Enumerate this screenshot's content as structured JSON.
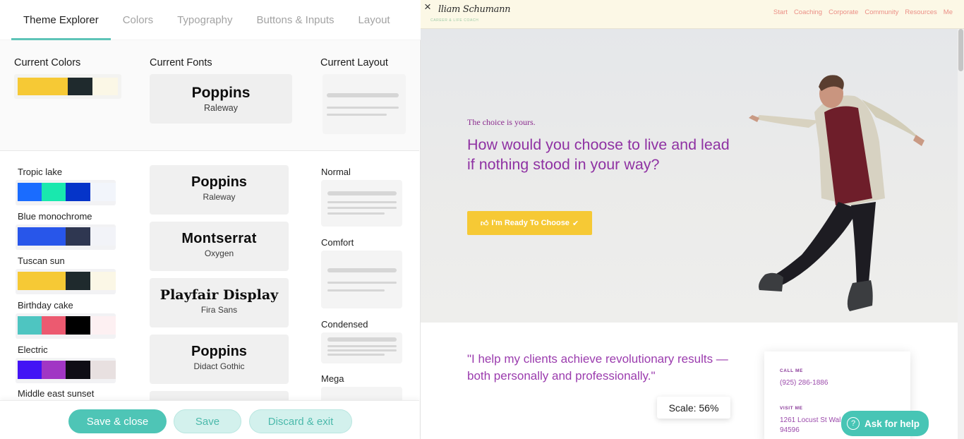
{
  "editor": {
    "tabs": [
      {
        "label": "Theme Explorer",
        "active": true
      },
      {
        "label": "Colors",
        "active": false
      },
      {
        "label": "Typography",
        "active": false
      },
      {
        "label": "Buttons & Inputs",
        "active": false
      },
      {
        "label": "Layout",
        "active": false
      }
    ],
    "current": {
      "colors_label": "Current Colors",
      "fonts_label": "Current Fonts",
      "layout_label": "Current Layout",
      "colors": [
        "#f6c935",
        "#1f2a2d",
        "#fbf7e6"
      ],
      "font_primary": "Poppins",
      "font_secondary": "Raleway"
    },
    "palettes": [
      {
        "name": "Tropic lake",
        "colors": [
          "#1a6cff",
          "#19e8ae",
          "#0534c9",
          "#f2f5fb"
        ]
      },
      {
        "name": "Blue monochrome",
        "colors": [
          "#2856ea",
          "#2856ea",
          "#2f3751",
          "#f2f3f8"
        ]
      },
      {
        "name": "Tuscan sun",
        "colors": [
          "#f6c935",
          "#f6c935",
          "#1f2a2d",
          "#fbf7e6"
        ]
      },
      {
        "name": "Birthday cake",
        "colors": [
          "#4ec5c1",
          "#ec5a70",
          "#000000",
          "#fdf0f2"
        ]
      },
      {
        "name": "Electric",
        "colors": [
          "#4313f5",
          "#a136c4",
          "#0f0d15",
          "#e8e0e0"
        ]
      },
      {
        "name": "Middle east sunset",
        "colors": []
      }
    ],
    "fonts": [
      {
        "primary": "Poppins",
        "secondary": "Raleway"
      },
      {
        "primary": "Montserrat",
        "secondary": "Oxygen"
      },
      {
        "primary": "Playfair Display",
        "secondary": "Fira Sans"
      },
      {
        "primary": "Poppins",
        "secondary": "Didact Gothic"
      }
    ],
    "layouts": [
      {
        "name": "Normal"
      },
      {
        "name": "Comfort"
      },
      {
        "name": "Condensed"
      },
      {
        "name": "Mega"
      }
    ],
    "buttons": {
      "save_close": "Save & close",
      "save": "Save",
      "discard_exit": "Discard & exit"
    }
  },
  "preview": {
    "close_icon": "×",
    "logo": "lliam Schumann",
    "logo_sub": "Career & Life Coach",
    "nav": [
      "Start",
      "Coaching",
      "Corporate",
      "Community",
      "Resources",
      "Me"
    ],
    "hero": {
      "kicker": "The choice is yours.",
      "title": "How would you choose to live and lead if nothing stood in your way?",
      "button": "I'm Ready To Choose"
    },
    "quote": "\"I help my clients achieve revolutionary results —both personally and professionally.\"",
    "contact": {
      "call_label": "CALL ME",
      "phone": "(925) 286-1886",
      "visit_label": "VISIT ME",
      "address_line1": "1261 Locust St Wal",
      "address_line2": "94596"
    },
    "scale": "Scale: 56%",
    "help_button": "Ask for help",
    "colors": {
      "accent_purple": "#8f32a3",
      "button_yellow": "#f6c935",
      "nav_coral": "#eb8f86",
      "header_bg": "#fcf8e6"
    }
  },
  "theme_colors": {
    "teal": "#4ec5b6",
    "teal_light": "#d3f1ed"
  }
}
